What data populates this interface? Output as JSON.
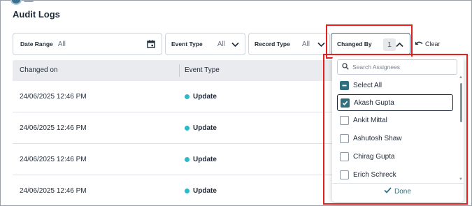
{
  "page": {
    "title": "Audit Logs"
  },
  "filters": {
    "date_range": {
      "label": "Date Range",
      "value": "All"
    },
    "event_type": {
      "label": "Event Type",
      "value": "All"
    },
    "record_type": {
      "label": "Record Type",
      "value": "All"
    },
    "changed_by": {
      "label": "Changed By",
      "count": "1"
    },
    "clear_label": "Clear"
  },
  "table": {
    "columns": [
      "Changed on",
      "Event Type"
    ],
    "rows": [
      {
        "changed_on": "24/06/2025 12:46 PM",
        "event_type": "Update"
      },
      {
        "changed_on": "24/06/2025 12:46 PM",
        "event_type": "Update"
      },
      {
        "changed_on": "24/06/2025 12:46 PM",
        "event_type": "Update"
      },
      {
        "changed_on": "24/06/2025 12:46 PM",
        "event_type": "Update"
      }
    ]
  },
  "dropdown": {
    "search_placeholder": "Search Assignees",
    "select_all_label": "Select All",
    "options": [
      {
        "label": "Akash Gupta",
        "checked": true
      },
      {
        "label": "Ankit Mittal",
        "checked": false
      },
      {
        "label": "Ashutosh Shaw",
        "checked": false
      },
      {
        "label": "Chirag Gupta",
        "checked": false
      },
      {
        "label": "Erich Schreck",
        "checked": false
      }
    ],
    "done_label": "Done"
  },
  "colors": {
    "accent": "#2f6f7e",
    "highlight": "#e4201f",
    "status_dot": "#2bbac8"
  },
  "icons": [
    "calendar-icon",
    "chevron-down-icon",
    "chevron-up-icon",
    "undo-icon",
    "search-icon",
    "check-icon"
  ]
}
